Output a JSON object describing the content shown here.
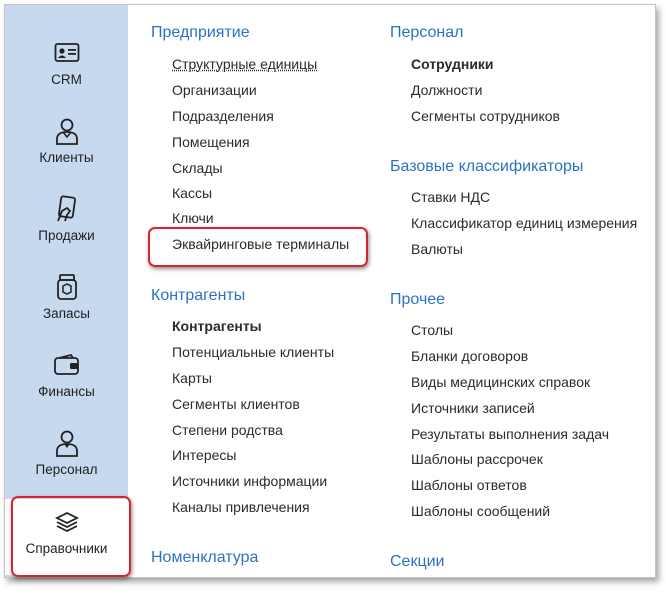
{
  "sidebar": {
    "items": [
      {
        "label": "CRM",
        "icon": "id-card-icon"
      },
      {
        "label": "Клиенты",
        "icon": "client-person-icon"
      },
      {
        "label": "Продажи",
        "icon": "card-payment-icon"
      },
      {
        "label": "Запасы",
        "icon": "jar-stock-icon"
      },
      {
        "label": "Финансы",
        "icon": "wallet-icon"
      },
      {
        "label": "Персонал",
        "icon": "staff-person-icon"
      },
      {
        "label": "Справочники",
        "icon": "books-stack-icon"
      }
    ],
    "active": "Справочники"
  },
  "sections": {
    "enterprise": {
      "title": "Предприятие",
      "links": [
        "Структурные единицы",
        "Организации",
        "Подразделения",
        "Помещения",
        "Склады",
        "Кассы",
        "Ключи",
        "Эквайринговые терминалы"
      ]
    },
    "counterparties": {
      "title": "Контрагенты",
      "links": [
        "Контрагенты",
        "Потенциальные клиенты",
        "Карты",
        "Сегменты клиентов",
        "Степени родства",
        "Интересы",
        "Источники информации",
        "Каналы привлечения"
      ]
    },
    "nomenclature": {
      "title": "Номенклатура"
    },
    "personnel": {
      "title": "Персонал",
      "links": [
        "Сотрудники",
        "Должности",
        "Сегменты сотрудников"
      ]
    },
    "classifiers": {
      "title": "Базовые классификаторы",
      "links": [
        "Ставки НДС",
        "Классификатор единиц измерения",
        "Валюты"
      ]
    },
    "other": {
      "title": "Прочее",
      "links": [
        "Столы",
        "Бланки договоров",
        "Виды медицинских справок",
        "Источники записей",
        "Результаты выполнения задач",
        "Шаблоны рассрочек",
        "Шаблоны ответов",
        "Шаблоны сообщений"
      ]
    },
    "sections_block": {
      "title": "Секции"
    }
  },
  "colors": {
    "sidebar_bg": "#c6d9ef",
    "section_title": "#2a73c2",
    "highlight": "#d9232e"
  }
}
